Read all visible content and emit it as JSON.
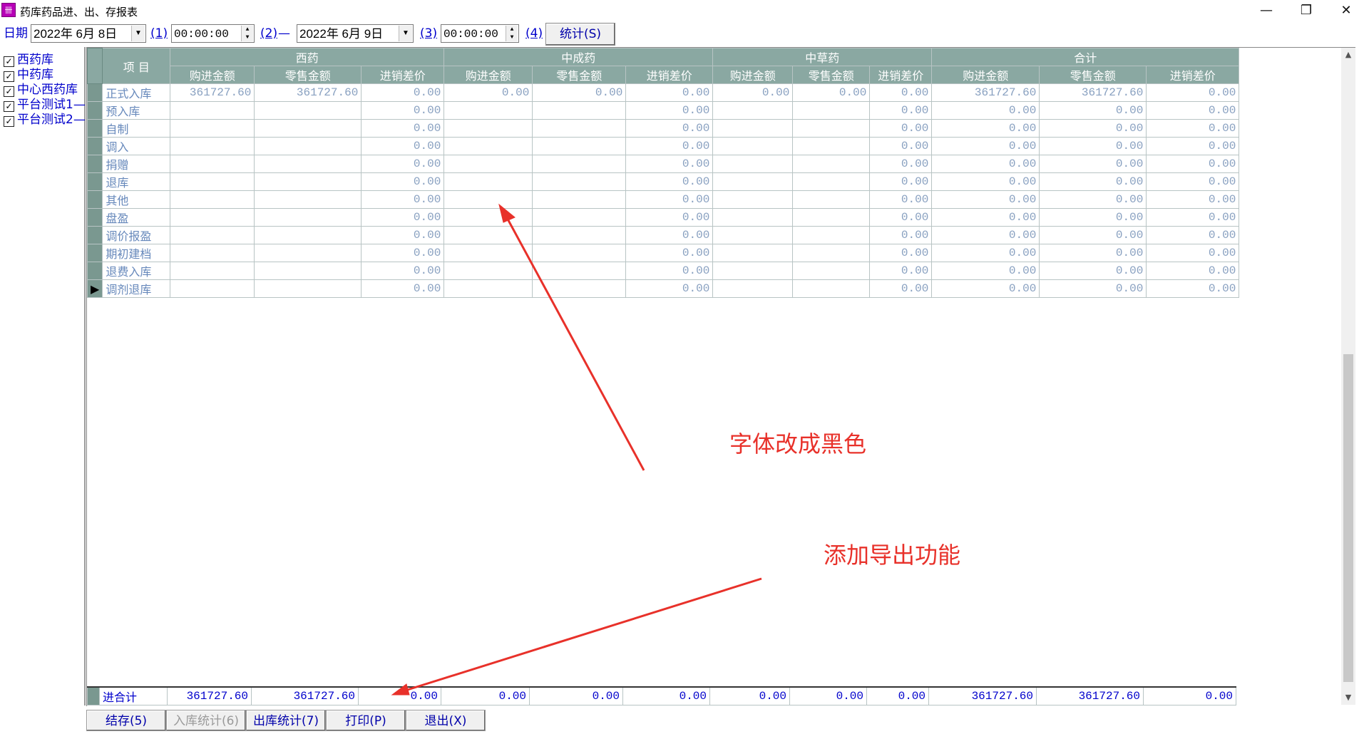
{
  "window": {
    "title": "药库药品进、出、存报表",
    "icon_glyph": "卌",
    "minimize_glyph": "—",
    "restore_glyph": "❐",
    "close_glyph": "✕"
  },
  "toolbar": {
    "date_label": "日期",
    "start_date": "2022年  6月  8日",
    "marker1": "(1)",
    "start_time": "00:00:00",
    "marker2": "(2)",
    "dash": "—",
    "end_date": "2022年  6月  9日",
    "marker3": "(3)",
    "end_time": "00:00:00",
    "marker4": "(4)",
    "stat_button": "统计(S)"
  },
  "tree": [
    {
      "label": "西药库",
      "checked": true
    },
    {
      "label": "中药库",
      "checked": true
    },
    {
      "label": "中心西药库",
      "checked": true
    },
    {
      "label": "平台测试1—",
      "checked": true
    },
    {
      "label": "平台测试2—",
      "checked": true
    }
  ],
  "grid": {
    "item_header": "项  目",
    "groups": [
      "西药",
      "中成药",
      "中草药",
      "合计"
    ],
    "subcols": [
      "购进金额",
      "零售金额",
      "进销差价"
    ],
    "rows": [
      {
        "label": "正式入库",
        "cells": [
          "361727.60",
          "361727.60",
          "0.00",
          "0.00",
          "0.00",
          "0.00",
          "0.00",
          "0.00",
          "0.00",
          "361727.60",
          "361727.60",
          "0.00"
        ]
      },
      {
        "label": "预入库",
        "cells": [
          "",
          "",
          "0.00",
          "",
          "",
          "0.00",
          "",
          "",
          "0.00",
          "0.00",
          "0.00",
          "0.00"
        ]
      },
      {
        "label": "自制",
        "cells": [
          "",
          "",
          "0.00",
          "",
          "",
          "0.00",
          "",
          "",
          "0.00",
          "0.00",
          "0.00",
          "0.00"
        ]
      },
      {
        "label": "调入",
        "cells": [
          "",
          "",
          "0.00",
          "",
          "",
          "0.00",
          "",
          "",
          "0.00",
          "0.00",
          "0.00",
          "0.00"
        ]
      },
      {
        "label": "捐赠",
        "cells": [
          "",
          "",
          "0.00",
          "",
          "",
          "0.00",
          "",
          "",
          "0.00",
          "0.00",
          "0.00",
          "0.00"
        ]
      },
      {
        "label": "退库",
        "cells": [
          "",
          "",
          "0.00",
          "",
          "",
          "0.00",
          "",
          "",
          "0.00",
          "0.00",
          "0.00",
          "0.00"
        ]
      },
      {
        "label": "其他",
        "cells": [
          "",
          "",
          "0.00",
          "",
          "",
          "0.00",
          "",
          "",
          "0.00",
          "0.00",
          "0.00",
          "0.00"
        ]
      },
      {
        "label": "盘盈",
        "cells": [
          "",
          "",
          "0.00",
          "",
          "",
          "0.00",
          "",
          "",
          "0.00",
          "0.00",
          "0.00",
          "0.00"
        ]
      },
      {
        "label": "调价报盈",
        "cells": [
          "",
          "",
          "0.00",
          "",
          "",
          "0.00",
          "",
          "",
          "0.00",
          "0.00",
          "0.00",
          "0.00"
        ]
      },
      {
        "label": "期初建档",
        "cells": [
          "",
          "",
          "0.00",
          "",
          "",
          "0.00",
          "",
          "",
          "0.00",
          "0.00",
          "0.00",
          "0.00"
        ]
      },
      {
        "label": "退费入库",
        "cells": [
          "",
          "",
          "0.00",
          "",
          "",
          "0.00",
          "",
          "",
          "0.00",
          "0.00",
          "0.00",
          "0.00"
        ]
      },
      {
        "label": "调剂退库",
        "cells": [
          "",
          "",
          "0.00",
          "",
          "",
          "0.00",
          "",
          "",
          "0.00",
          "0.00",
          "0.00",
          "0.00"
        ]
      }
    ],
    "total": {
      "label": "进合计",
      "cells": [
        "361727.60",
        "361727.60",
        "0.00",
        "0.00",
        "0.00",
        "0.00",
        "0.00",
        "0.00",
        "0.00",
        "361727.60",
        "361727.60",
        "0.00"
      ]
    }
  },
  "buttons": {
    "save": "结存(5)",
    "in_stat": "入库统计(6)",
    "out_stat": "出库统计(7)",
    "print": "打印(P)",
    "exit": "退出(X)"
  },
  "annotations": {
    "font_note": "字体改成黑色",
    "export_note": "添加导出功能",
    "color": "#e8312a"
  }
}
